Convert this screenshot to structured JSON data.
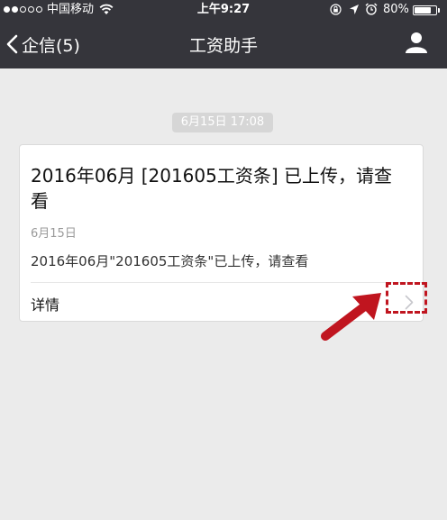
{
  "status_bar": {
    "carrier": "中国移动",
    "time": "上午9:27",
    "battery_percent": "80%",
    "battery_level": 0.8,
    "signal_bars_filled": 2,
    "signal_bars_total": 5
  },
  "nav": {
    "back_label": "企信(5)",
    "title": "工资助手"
  },
  "chat": {
    "timestamp": "6月15日 17:08",
    "card": {
      "title": "2016年06月 [201605工资条] 已上传，请查看",
      "date": "6月15日",
      "body": "2016年06月\"201605工资条\"已上传，请查看",
      "details_label": "详情"
    }
  },
  "icons": {
    "back": "chevron-left-icon",
    "profile": "user-icon",
    "details": "chevron-right-icon",
    "annotation": "arrow-icon"
  },
  "colors": {
    "nav_background": "#35353b",
    "page_background": "#ebebeb",
    "annotation_red": "#c0151f"
  }
}
